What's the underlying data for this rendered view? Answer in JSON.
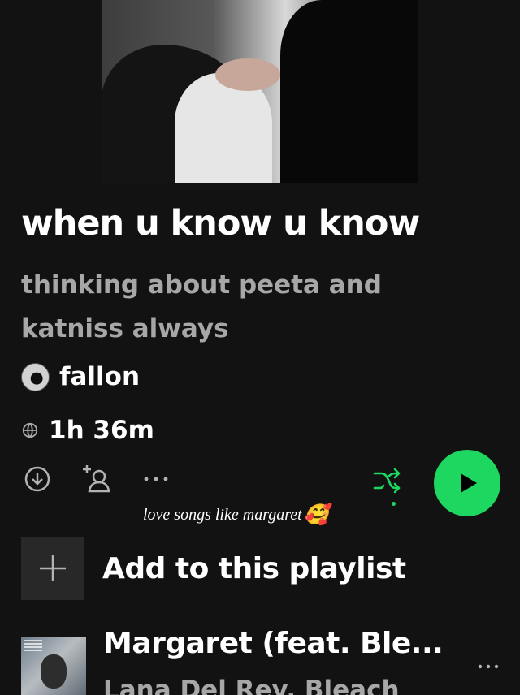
{
  "playlist": {
    "title": "when u know u know",
    "description": "thinking about peeta and katniss always",
    "owner": "fallon",
    "duration": "1h 36m"
  },
  "caption": {
    "text": "love songs like margaret",
    "emoji": "🥰"
  },
  "add_row": {
    "label": "Add to this playlist"
  },
  "tracks": [
    {
      "title": "Margaret (feat. Ble...",
      "artist": "Lana Del Rey, Bleach"
    }
  ],
  "colors": {
    "background": "#121212",
    "accent": "#1ed760",
    "secondary_text": "#a7a7a7"
  },
  "icons": {
    "download": "download-icon",
    "add_user": "add-user-icon",
    "more": "more-icon",
    "shuffle": "shuffle-icon",
    "play": "play-icon",
    "globe": "globe-icon",
    "plus": "plus-icon"
  }
}
